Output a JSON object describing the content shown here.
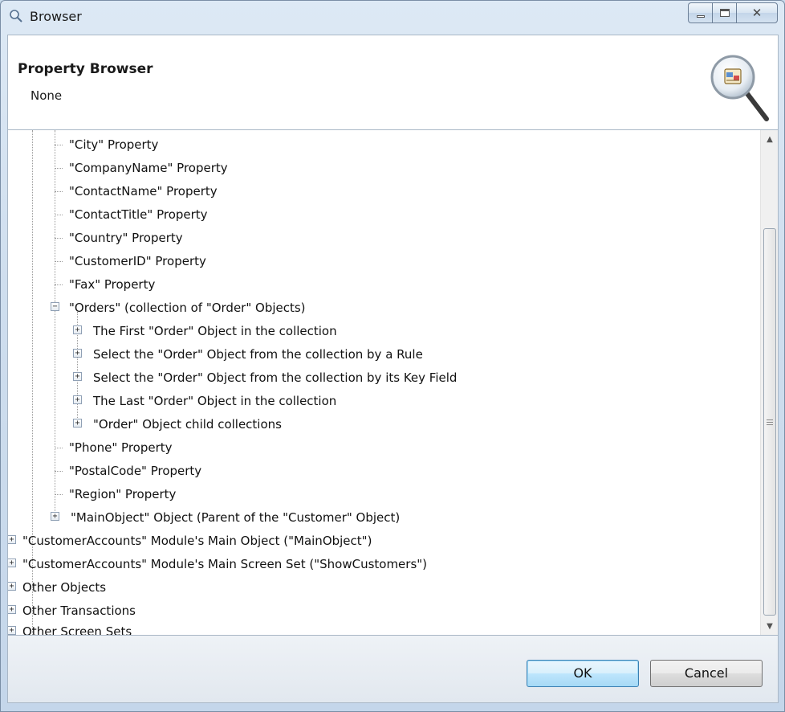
{
  "window": {
    "title": "Browser"
  },
  "header": {
    "title": "Property Browser",
    "subtitle": "None"
  },
  "tree": {
    "rows": [
      {
        "label": "\"City\" Property"
      },
      {
        "label": "\"CompanyName\" Property"
      },
      {
        "label": "\"ContactName\" Property"
      },
      {
        "label": "\"ContactTitle\" Property"
      },
      {
        "label": "\"Country\" Property"
      },
      {
        "label": "\"CustomerID\" Property"
      },
      {
        "label": "\"Fax\" Property"
      },
      {
        "label": "\"Orders\" (collection of \"Order\" Objects)",
        "toggle": "−"
      },
      {
        "label": "The First \"Order\" Object in the collection",
        "toggle": "+"
      },
      {
        "label": "Select the \"Order\" Object from the collection by a Rule",
        "toggle": "+"
      },
      {
        "label": "Select the \"Order\" Object from the collection by its Key Field",
        "toggle": "+"
      },
      {
        "label": "The Last \"Order\" Object in the collection",
        "toggle": "+"
      },
      {
        "label": "\"Order\" Object child collections",
        "toggle": "+"
      },
      {
        "label": "\"Phone\" Property"
      },
      {
        "label": "\"PostalCode\" Property"
      },
      {
        "label": "\"Region\" Property"
      },
      {
        "label": "\"MainObject\" Object (Parent of the \"Customer\" Object)",
        "toggle": "+"
      },
      {
        "label": "\"CustomerAccounts\" Module's Main Object (\"MainObject\")",
        "toggle": "+"
      },
      {
        "label": "\"CustomerAccounts\" Module's Main Screen Set (\"ShowCustomers\")",
        "toggle": "+"
      },
      {
        "label": "Other Objects",
        "toggle": "+"
      },
      {
        "label": "Other Transactions",
        "toggle": "+"
      },
      {
        "label": "Other Screen Sets",
        "toggle": "+"
      }
    ]
  },
  "footer": {
    "ok_label": "OK",
    "cancel_label": "Cancel"
  },
  "colors": {
    "ok_accent": "#3c7fb1",
    "window_frame": "#c4d6ea"
  }
}
